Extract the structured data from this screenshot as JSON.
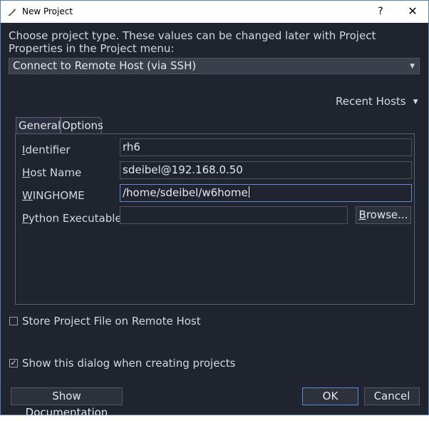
{
  "window": {
    "title": "New Project",
    "help_label": "?",
    "close_label": "✕"
  },
  "intro_text": "Choose project type.  These values can be changed later with Project Properties in the Project menu:",
  "project_type": {
    "selected": "Connect to Remote Host (via SSH)"
  },
  "recent_hosts_label": "Recent Hosts",
  "tabs": [
    {
      "label": "General",
      "active": true
    },
    {
      "label": "Options",
      "active": false
    }
  ],
  "fields": {
    "identifier": {
      "label_first": "I",
      "label_rest": "dentifier",
      "value": "rh6"
    },
    "host_name": {
      "label_first": "H",
      "label_rest": "ost Name",
      "value": "sdeibel@192.168.0.50"
    },
    "winghome": {
      "label_first": "W",
      "label_rest": "INGHOME",
      "value": "/home/sdeibel/w6home"
    },
    "python_executable": {
      "label_first": "P",
      "label_rest": "ython Executable",
      "value": ""
    }
  },
  "browse": {
    "label_first": "B",
    "label_rest": "rowse..."
  },
  "store_remote": {
    "label": "Store Project File on Remote Host",
    "checked": false
  },
  "show_dialog": {
    "label": "Show this dialog when creating projects",
    "checked": true
  },
  "buttons": {
    "documentation": "Show Documentation",
    "ok": "OK",
    "cancel": "Cancel"
  },
  "colors": {
    "background": "#20242f",
    "accent": "#5b8bd8"
  }
}
